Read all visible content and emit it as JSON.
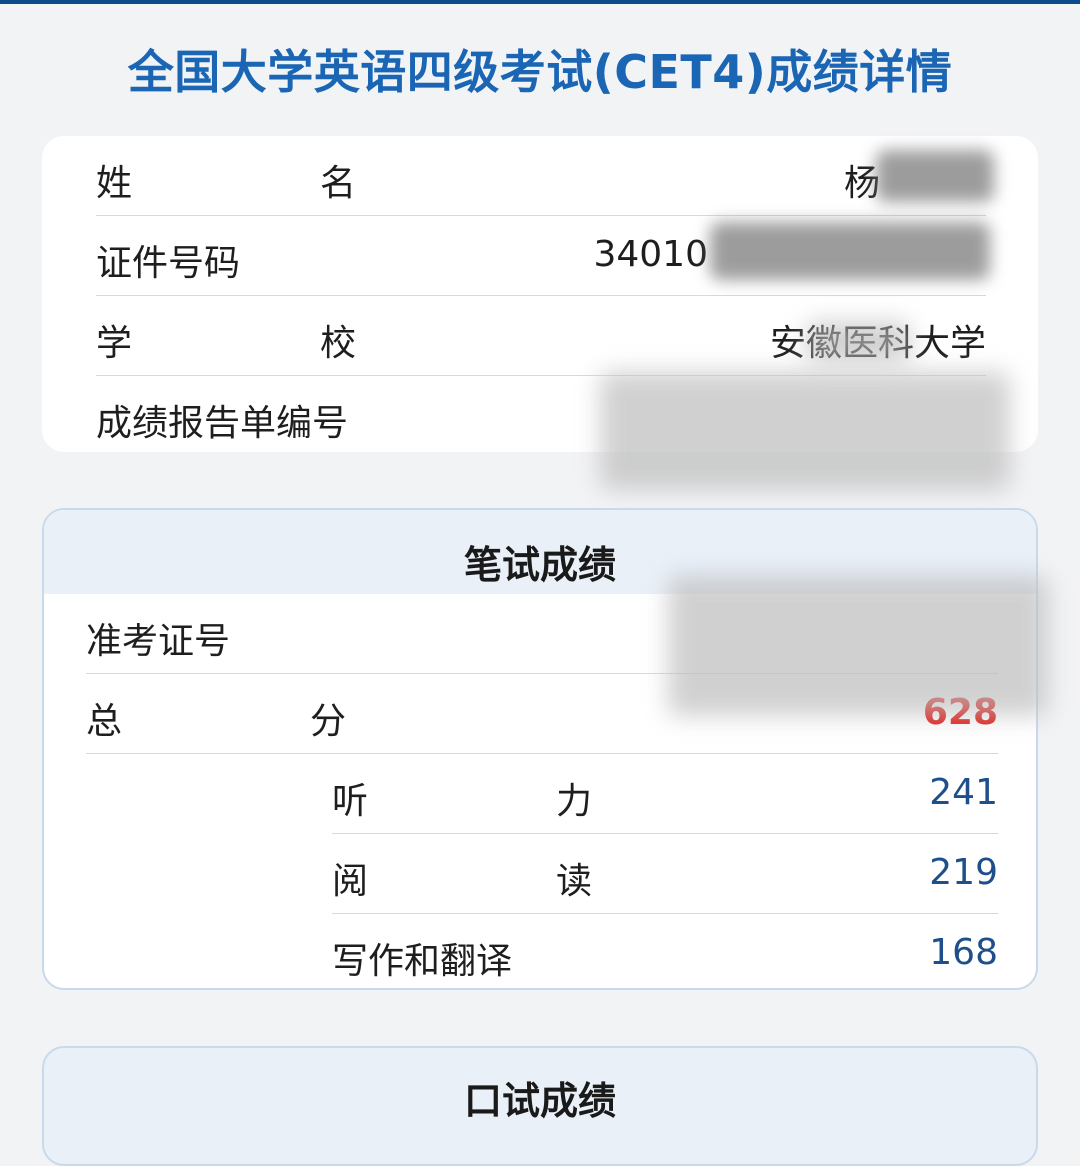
{
  "page": {
    "title": "全国大学英语四级考试(CET4)成绩详情"
  },
  "personal_info": {
    "name": {
      "label": "姓　名",
      "value": "杨"
    },
    "id_number": {
      "label": "证件号码",
      "value": "34010"
    },
    "school": {
      "label": "学　校",
      "value": "安徽医科大学"
    },
    "report_number": {
      "label": "成绩报告单编号",
      "value": ""
    }
  },
  "written_scores": {
    "title": "笔试成绩",
    "ticket_number": {
      "label": "准考证号",
      "value": ""
    },
    "total": {
      "label": "总　分",
      "value": "628"
    },
    "sections": [
      {
        "label": "听　力",
        "value": "241"
      },
      {
        "label": "阅　读",
        "value": "219"
      },
      {
        "label": "写作和翻译",
        "value": "168"
      }
    ]
  },
  "oral_scores": {
    "title": "口试成绩"
  },
  "colors": {
    "accent": "#1a66b5",
    "total_score": "#e0201c",
    "sub_score": "#1e4f8a",
    "top_bar": "#0b4a8b"
  }
}
